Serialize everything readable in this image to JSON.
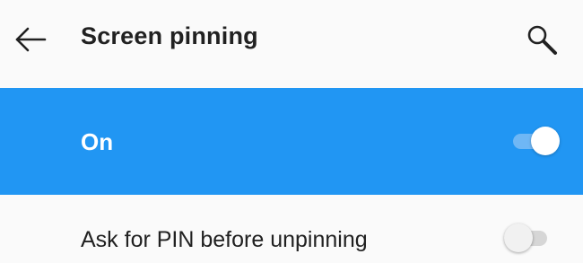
{
  "app_bar": {
    "title": "Screen pinning",
    "back_icon": "arrow-left-icon",
    "search_icon": "search-icon"
  },
  "settings": {
    "main_switch": {
      "label": "On",
      "checked": true
    },
    "ask_pin": {
      "label": "Ask for PIN before unpinning",
      "checked": false
    }
  },
  "colors": {
    "accent": "#2196f3",
    "background": "#fafafa",
    "text_primary": "#212121",
    "on_accent_text": "#ffffff"
  }
}
